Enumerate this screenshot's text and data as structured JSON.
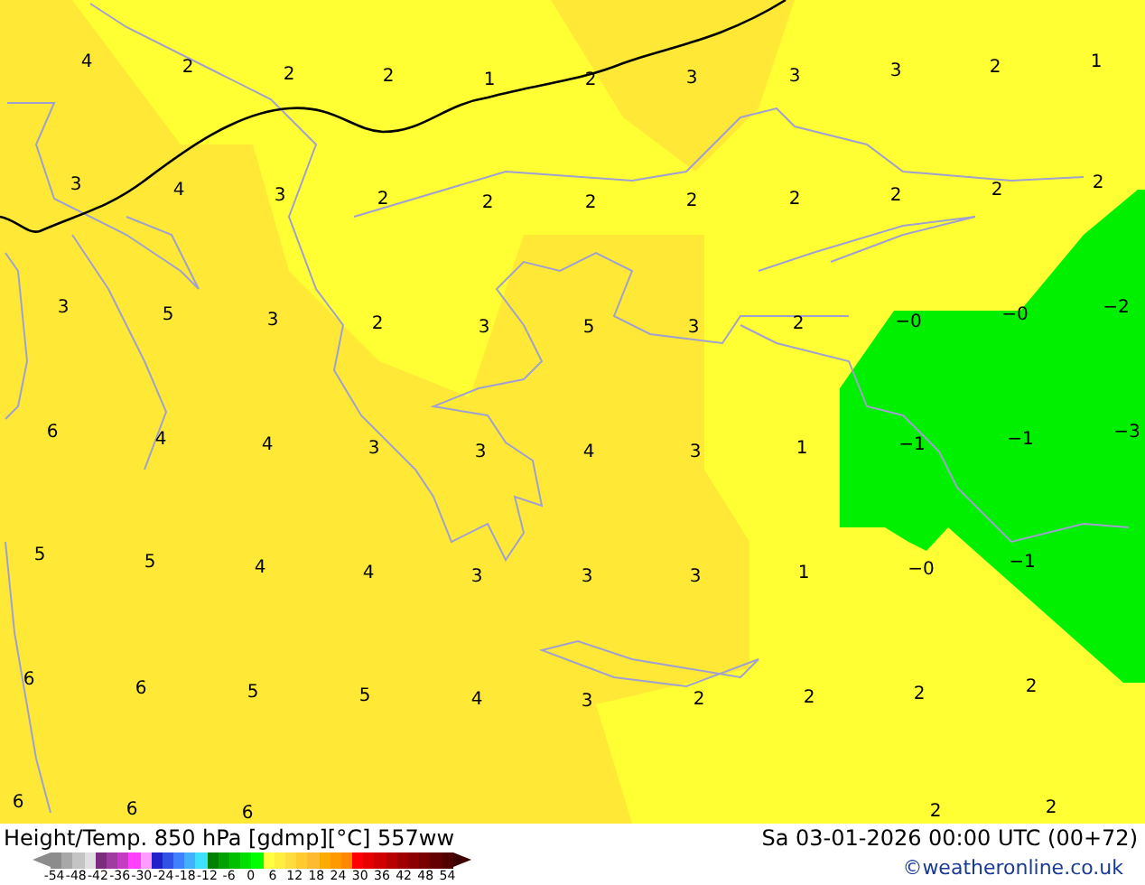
{
  "map": {
    "value_rows": [
      [
        "4",
        "2",
        "2",
        "2",
        "1",
        "2",
        "3",
        "3",
        "3",
        "2",
        "1"
      ],
      [
        "3",
        "4",
        "3",
        "2",
        "2",
        "2",
        "2",
        "2",
        "2",
        "2",
        "2"
      ],
      [
        "3",
        "5",
        "3",
        "2",
        "3",
        "5",
        "3",
        "2",
        "−0",
        "−0",
        "−2"
      ],
      [
        "6",
        "4",
        "4",
        "3",
        "3",
        "4",
        "3",
        "1",
        "−1",
        "−1",
        "−3"
      ],
      [
        "5",
        "5",
        "4",
        "4",
        "3",
        "3",
        "3",
        "1",
        "−0",
        "−1"
      ],
      [
        "6",
        "6",
        "5",
        "5",
        "4",
        "3",
        "2",
        "2",
        "2",
        "2"
      ],
      [
        "6",
        "6",
        "6",
        "",
        "",
        "",
        "",
        "",
        "2",
        "2"
      ]
    ]
  },
  "legend": {
    "title": "Height/Temp. 850 hPa [gdmp][°C] 557ww",
    "swatches": [
      {
        "color": "#8c8c8c"
      },
      {
        "color": "#a8a8a8"
      },
      {
        "color": "#c4c4c4"
      },
      {
        "color": "#e0e0e0"
      },
      {
        "color": "#7c2c7c"
      },
      {
        "color": "#a03ca0"
      },
      {
        "color": "#c43cc4"
      },
      {
        "color": "#ff40ff"
      },
      {
        "color": "#ff9cff"
      },
      {
        "color": "#2020c8"
      },
      {
        "color": "#3050e8"
      },
      {
        "color": "#4080ff"
      },
      {
        "color": "#40b0ff"
      },
      {
        "color": "#40e0ff"
      },
      {
        "color": "#008000"
      },
      {
        "color": "#00a000"
      },
      {
        "color": "#00c000"
      },
      {
        "color": "#00e000"
      },
      {
        "color": "#00ff00"
      },
      {
        "color": "#ffff40"
      },
      {
        "color": "#ffee40"
      },
      {
        "color": "#ffdd40"
      },
      {
        "color": "#ffcc30"
      },
      {
        "color": "#ffbb30"
      },
      {
        "color": "#ffaa00"
      },
      {
        "color": "#ff9900"
      },
      {
        "color": "#ff8800"
      },
      {
        "color": "#ff0000"
      },
      {
        "color": "#e80000"
      },
      {
        "color": "#d00000"
      },
      {
        "color": "#b80000"
      },
      {
        "color": "#a00000"
      },
      {
        "color": "#8c0000"
      },
      {
        "color": "#780000"
      },
      {
        "color": "#640000"
      },
      {
        "color": "#500000"
      }
    ],
    "ticks": [
      "-54",
      "-48",
      "-42",
      "-36",
      "-30",
      "-24",
      "-18",
      "-12",
      "-6",
      "0",
      "6",
      "12",
      "18",
      "24",
      "30",
      "36",
      "42",
      "48",
      "54"
    ]
  },
  "timestamp": "Sa 03-01-2026 00:00 UTC (00+72)",
  "copyright": "©weatheronline.co.uk"
}
